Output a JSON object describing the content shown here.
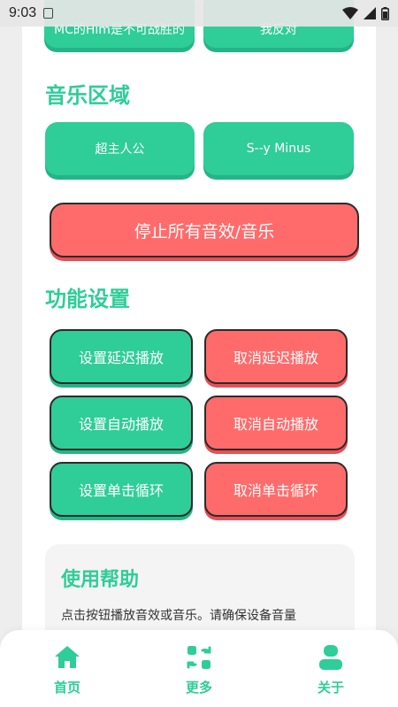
{
  "status_bar": {
    "time": "9:03"
  },
  "top_buttons": [
    {
      "label": "MC的Him是不可战胜的"
    },
    {
      "label": "我反对"
    }
  ],
  "music_section": {
    "title": "音乐区域",
    "buttons": [
      {
        "label": "超主人公"
      },
      {
        "label": "S--y Minus"
      }
    ],
    "stop_button": "停止所有音效/音乐"
  },
  "settings_section": {
    "title": "功能设置",
    "rows": [
      {
        "set": "设置延迟播放",
        "cancel": "取消延迟播放"
      },
      {
        "set": "设置自动播放",
        "cancel": "取消自动播放"
      },
      {
        "set": "设置单击循环",
        "cancel": "取消单击循环"
      }
    ]
  },
  "help": {
    "title": "使用帮助",
    "text": "点击按钮播放音效或音乐。请确保设备音量"
  },
  "bottom_nav": [
    {
      "label": "首页",
      "icon": "home-icon"
    },
    {
      "label": "更多",
      "icon": "apps-icon"
    },
    {
      "label": "关于",
      "icon": "person-icon"
    }
  ],
  "colors": {
    "accent": "#2fcd98",
    "danger": "#ff6b6b"
  }
}
